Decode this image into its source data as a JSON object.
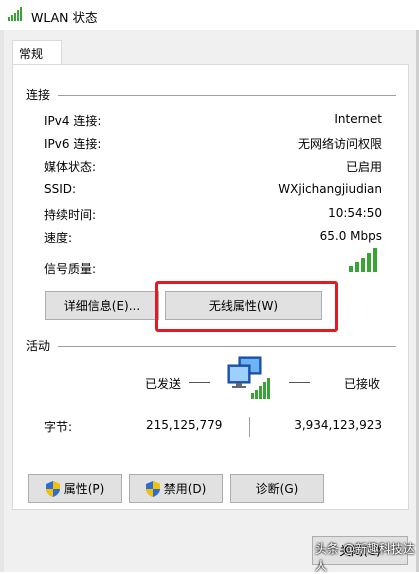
{
  "window": {
    "title": "WLAN 状态"
  },
  "tabs": [
    {
      "label": "常规"
    }
  ],
  "connection": {
    "section_title": "连接",
    "rows": [
      {
        "label": "IPv4 连接:",
        "value": "Internet"
      },
      {
        "label": "IPv6 连接:",
        "value": "无网络访问权限"
      },
      {
        "label": "媒体状态:",
        "value": "已启用"
      },
      {
        "label": "SSID:",
        "value": "WXjichangjiudian"
      },
      {
        "label": "持续时间:",
        "value": "10:54:50"
      },
      {
        "label": "速度:",
        "value": "65.0 Mbps"
      }
    ],
    "signal_label": "信号质量:",
    "signal_bars": 5,
    "details_button": "详细信息(E)...",
    "wireless_props_button": "无线属性(W)"
  },
  "activity": {
    "section_title": "活动",
    "sent_label": "已发送",
    "received_label": "已接收",
    "bytes_label": "字节:",
    "sent_bytes": "215,125,779",
    "received_bytes": "3,934,123,923"
  },
  "buttons": {
    "properties": "属性(P)",
    "disable": "禁用(D)",
    "diagnose": "诊断(G)",
    "close": "关闭(C)"
  },
  "watermark": "头条 @新趣科技达人",
  "colors": {
    "highlight": "#e11b22",
    "signal": "#3aa335"
  }
}
